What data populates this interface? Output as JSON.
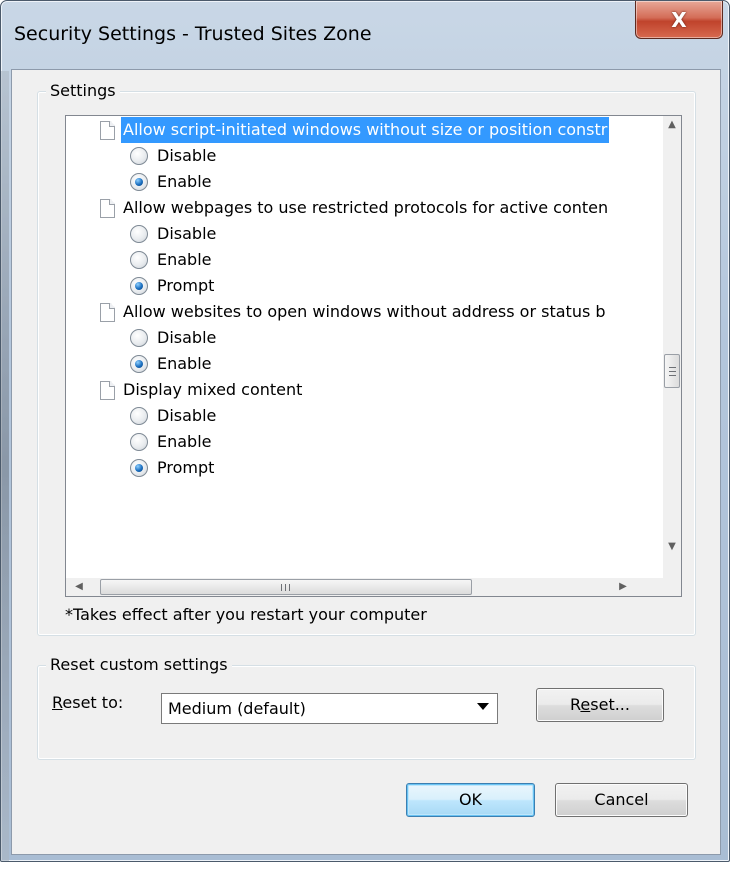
{
  "window": {
    "title": "Security Settings - Trusted Sites Zone",
    "close_glyph": "X"
  },
  "settings_group": {
    "legend": "Settings",
    "items": [
      {
        "type": "setting",
        "label": "Allow script-initiated windows without size or position constr",
        "selected": true
      },
      {
        "type": "option",
        "label": "Disable",
        "checked": false
      },
      {
        "type": "option",
        "label": "Enable",
        "checked": true
      },
      {
        "type": "setting",
        "label": "Allow webpages to use restricted protocols for active conten",
        "selected": false
      },
      {
        "type": "option",
        "label": "Disable",
        "checked": false
      },
      {
        "type": "option",
        "label": "Enable",
        "checked": false
      },
      {
        "type": "option",
        "label": "Prompt",
        "checked": true
      },
      {
        "type": "setting",
        "label": "Allow websites to open windows without address or status b",
        "selected": false
      },
      {
        "type": "option",
        "label": "Disable",
        "checked": false
      },
      {
        "type": "option",
        "label": "Enable",
        "checked": true
      },
      {
        "type": "setting",
        "label": "Display mixed content",
        "selected": false
      },
      {
        "type": "option",
        "label": "Disable",
        "checked": false
      },
      {
        "type": "option",
        "label": "Enable",
        "checked": false
      },
      {
        "type": "option",
        "label": "Prompt",
        "checked": true
      }
    ],
    "note": "*Takes effect after you restart your computer"
  },
  "reset_group": {
    "legend": "Reset custom settings",
    "reset_to_label_first": "R",
    "reset_to_label_rest": "eset to:",
    "selected_level": "Medium (default)",
    "reset_button_pre": "R",
    "reset_button_u": "e",
    "reset_button_post": "set..."
  },
  "buttons": {
    "ok": "OK",
    "cancel": "Cancel"
  },
  "colors": {
    "selection": "#3399ff",
    "dialog_bg": "#f0f0f0",
    "close_button": "#c0432c"
  }
}
